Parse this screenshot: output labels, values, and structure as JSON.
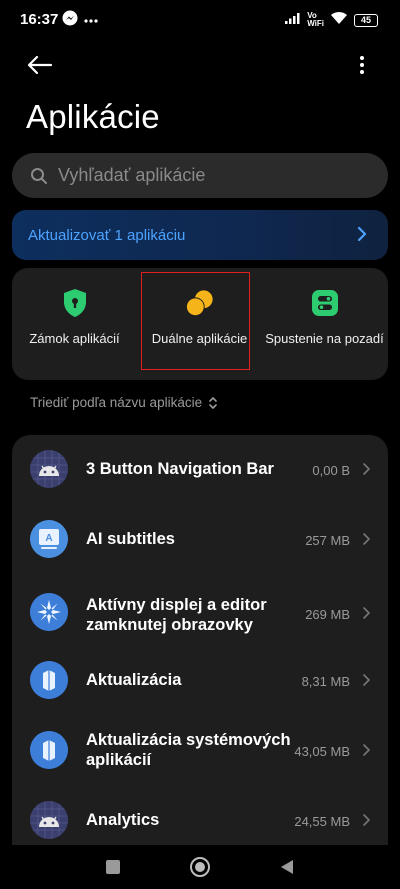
{
  "status_bar": {
    "time": "16:37",
    "volte_top": "Vo",
    "volte_bottom": "WiFi",
    "battery": "45"
  },
  "header": {
    "title": "Aplikácie"
  },
  "search": {
    "placeholder": "Vyhľadať aplikácie"
  },
  "update_banner": {
    "label": "Aktualizovať 1 aplikáciu"
  },
  "quick_actions": [
    {
      "label": "Zámok aplikácií",
      "icon": "shield-lock-icon",
      "color": "#2ecc71"
    },
    {
      "label": "Duálne aplikácie",
      "icon": "dual-apps-icon",
      "color": "#f5b41a"
    },
    {
      "label": "Spustenie na pozadí",
      "icon": "autostart-icon",
      "color": "#2ecc71"
    }
  ],
  "sort": {
    "label": "Triediť podľa názvu aplikácie"
  },
  "apps": [
    {
      "name": "3 Button Navigation Bar",
      "size": "0,00 B",
      "icon": "android-icon"
    },
    {
      "name": "AI subtitles",
      "size": "257 MB",
      "icon": "subtitles-icon"
    },
    {
      "name": "Aktívny displej a editor zamknutej obrazovky",
      "size": "269 MB",
      "icon": "display-editor-icon"
    },
    {
      "name": "Aktualizácia",
      "size": "8,31 MB",
      "icon": "update-icon"
    },
    {
      "name": "Aktualizácia systémových aplikácií",
      "size": "43,05 MB",
      "icon": "system-update-icon"
    },
    {
      "name": "Analytics",
      "size": "24,55 MB",
      "icon": "android-icon"
    }
  ],
  "colors": {
    "accent_blue": "#4da3ff",
    "panel": "#1e1e1e",
    "highlight_red": "#e02020"
  }
}
